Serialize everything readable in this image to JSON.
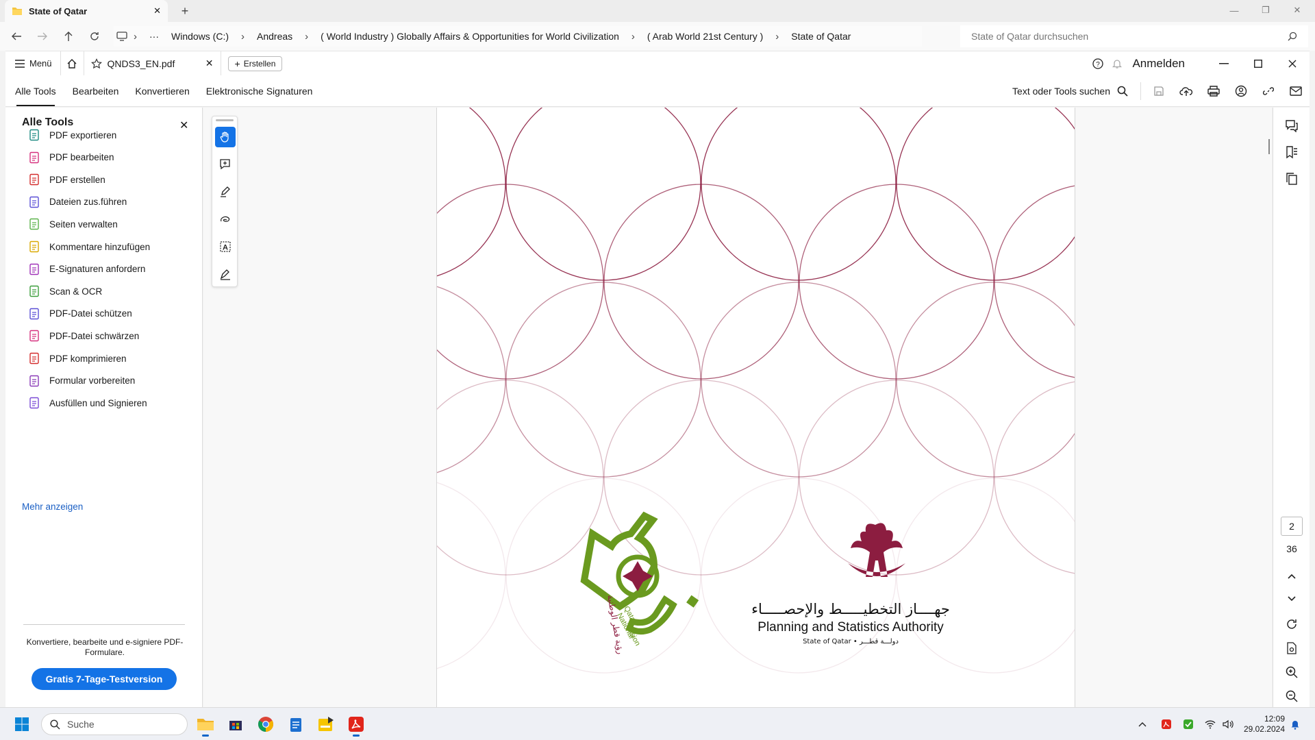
{
  "explorer": {
    "tab_title": "State of Qatar",
    "breadcrumbs": [
      "Windows (C:)",
      "Andreas",
      "( World Industry ) Globally Affairs & Opportunities for World Civilization",
      "( Arab World 21st Century )",
      "State of Qatar"
    ],
    "search_placeholder": "State of Qatar durchsuchen"
  },
  "acrobat": {
    "menu_label": "Menü",
    "doc_tab": "QNDS3_EN.pdf",
    "create_label": "Erstellen",
    "signin_label": "Anmelden",
    "nav_tabs": [
      "Alle Tools",
      "Bearbeiten",
      "Konvertieren",
      "Elektronische Signaturen"
    ],
    "tools_search": "Text oder Tools suchen"
  },
  "tools_panel": {
    "title": "Alle Tools",
    "items": [
      {
        "label": "PDF exportieren",
        "color": "#1d8a82"
      },
      {
        "label": "PDF bearbeiten",
        "color": "#d6307e"
      },
      {
        "label": "PDF erstellen",
        "color": "#d42d2d"
      },
      {
        "label": "Dateien zus.führen",
        "color": "#5a4fd6"
      },
      {
        "label": "Seiten verwalten",
        "color": "#5bb24a"
      },
      {
        "label": "Kommentare hinzufügen",
        "color": "#d9a800"
      },
      {
        "label": "E-Signaturen anfordern",
        "color": "#a032b8"
      },
      {
        "label": "Scan & OCR",
        "color": "#3c9e3c"
      },
      {
        "label": "PDF-Datei schützen",
        "color": "#5a4fd6"
      },
      {
        "label": "PDF-Datei schwärzen",
        "color": "#d6307e"
      },
      {
        "label": "PDF komprimieren",
        "color": "#d42d2d"
      },
      {
        "label": "Formular vorbereiten",
        "color": "#8a3ab8"
      },
      {
        "label": "Ausfüllen und Signieren",
        "color": "#7a4ad6"
      }
    ],
    "more_label": "Mehr anzeigen",
    "promo_text": "Konvertiere, bearbeite und e-signiere PDF-Formulare.",
    "trial_button": "Gratis 7-Tage-Testversion"
  },
  "document": {
    "psa_arabic": "جهــــاز التخطيـــــط والإحصـــــاء",
    "psa_english": "Planning and Statistics Authority",
    "psa_state": "State of Qatar • دولـــة قطـــر",
    "qnv_lines": [
      "Qatar",
      "National",
      "Vision"
    ],
    "qnv_arabic": "رؤية قطر الوطنية",
    "pattern_color": "#8c1d40",
    "vision_color": "#6a9a1f"
  },
  "right_rail": {
    "current_page": "2",
    "total_pages": "36"
  },
  "taskbar": {
    "search_label": "Suche",
    "time": "12:09",
    "date": "29.02.2024"
  }
}
